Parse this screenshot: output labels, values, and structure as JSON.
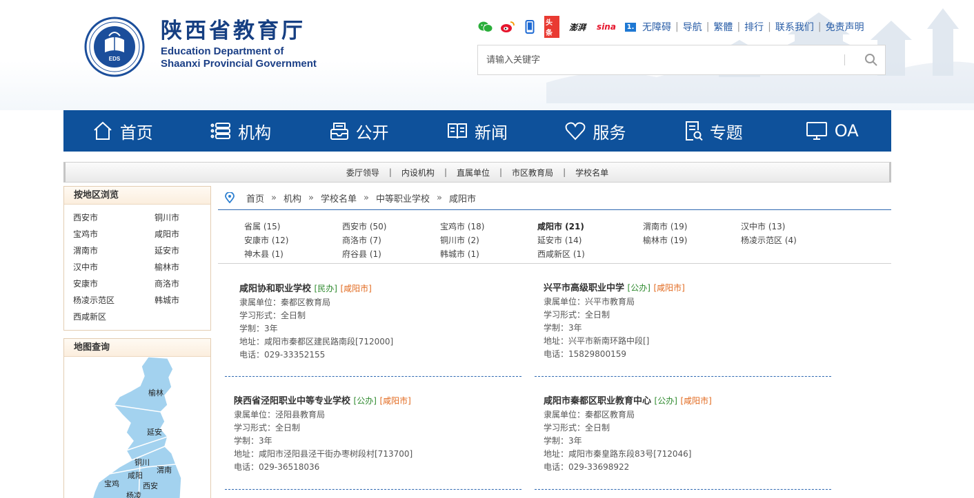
{
  "site": {
    "name_cn": "陕西省教育厅",
    "name_en_line1": "Education Department of",
    "name_en_line2": "Shaanxi Provincial Government",
    "emblem_center": "EDS"
  },
  "toplinks": {
    "social_icons": [
      "wechat-icon",
      "weibo-icon",
      "mobile-icon",
      "toutiao-icon",
      "pengpai-icon",
      "sina-icon",
      "yidian-icon"
    ],
    "toutiao_label": "头条",
    "pengpai_label": "澎湃",
    "sina_label": "sina",
    "yidian_label": "1.",
    "links": [
      "无障碍",
      "导航",
      "繁體",
      "排行",
      "联系我们",
      "免责声明"
    ]
  },
  "search": {
    "placeholder": "请输入关键字"
  },
  "nav": {
    "items": [
      {
        "label": "首页",
        "icon": "home-icon"
      },
      {
        "label": "机构",
        "icon": "list-icon"
      },
      {
        "label": "公开",
        "icon": "inbox-icon"
      },
      {
        "label": "新闻",
        "icon": "book-icon"
      },
      {
        "label": "服务",
        "icon": "heart-icon"
      },
      {
        "label": "专题",
        "icon": "doc-search-icon"
      },
      {
        "label": "OA",
        "icon": "monitor-icon"
      }
    ]
  },
  "subnav": {
    "items": [
      "委厅领导",
      "内设机构",
      "直属单位",
      "市区教育局",
      "学校名单"
    ]
  },
  "sidebar": {
    "region_title": "按地区浏览",
    "regions": [
      "西安市",
      "铜川市",
      "宝鸡市",
      "咸阳市",
      "渭南市",
      "延安市",
      "汉中市",
      "榆林市",
      "安康市",
      "商洛市",
      "杨凌示范区",
      "韩城市",
      "西咸新区"
    ],
    "map_title": "地图查询",
    "map_labels": [
      "榆林",
      "延安",
      "铜川",
      "渭南",
      "咸阳",
      "宝鸡",
      "西安",
      "杨凌"
    ]
  },
  "breadcrumb": [
    "首页",
    "机构",
    "学校名单",
    "中等职业学校",
    "咸阳市"
  ],
  "breadcrumb_sep": "»",
  "cities": [
    "省属 (15)",
    "西安市 (50)",
    "宝鸡市 (18)",
    "咸阳市 (21)",
    "渭南市 (19)",
    "汉中市 (13)",
    "安康市 (12)",
    "商洛市 (7)",
    "铜川市 (2)",
    "延安市 (14)",
    "榆林市 (19)",
    "杨凌示范区 (4)",
    "神木县 (1)",
    "府谷县 (1)",
    "韩城市 (1)",
    "西咸新区 (1)"
  ],
  "schools": [
    {
      "name": "咸阳协和职业学校",
      "type": "[民办]",
      "city": "[咸阳市]",
      "unit": "隶属单位：秦都区教育局",
      "form": "学习形式：全日制",
      "years": "学制：3年",
      "addr": "地址：咸阳市秦都区建民路南段[712000]",
      "tel": "电话：029-33352155"
    },
    {
      "name": "兴平市高级职业中学",
      "type": "[公办]",
      "city": "[咸阳市]",
      "unit": "隶属单位：兴平市教育局",
      "form": "学习形式：全日制",
      "years": "学制：3年",
      "addr": "地址：兴平市新南环路中段[]",
      "tel": "电话：15829800159"
    },
    {
      "name": "陕西省泾阳职业中等专业学校",
      "type": "[公办]",
      "city": "[咸阳市]",
      "unit": "隶属单位：泾阳县教育局",
      "form": "学习形式：全日制",
      "years": "学制：3年",
      "addr": "地址：咸阳市泾阳县泾干街办枣树段村[713700]",
      "tel": "电话：029-36518036"
    },
    {
      "name": "咸阳市秦都区职业教育中心",
      "type": "[公办]",
      "city": "[咸阳市]",
      "unit": "隶属单位：秦都区教育局",
      "form": "学习形式：全日制",
      "years": "学制：3年",
      "addr": "地址：咸阳市秦皇路东段83号[712046]",
      "tel": "电话：029-33698922"
    }
  ]
}
